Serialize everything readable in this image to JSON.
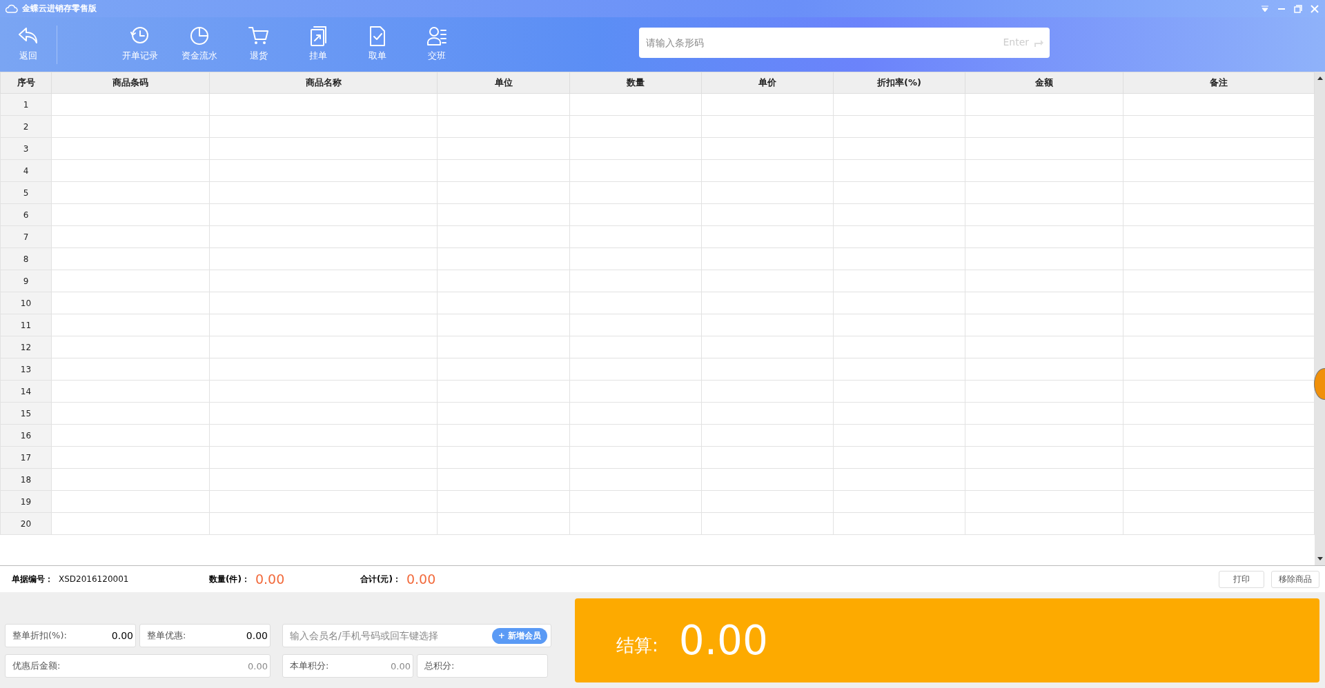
{
  "window": {
    "title": "金蝶云进销存零售版"
  },
  "toolbar": {
    "back": "返回",
    "items": [
      "开单记录",
      "资金流水",
      "退货",
      "挂单",
      "取单",
      "交班"
    ]
  },
  "barcode_field": {
    "placeholder": "请输入条形码",
    "hint": "Enter"
  },
  "table": {
    "columns": [
      "序号",
      "商品条码",
      "商品名称",
      "单位",
      "数量",
      "单价",
      "折扣率(%)",
      "金额",
      "备注"
    ],
    "rows": [
      "1",
      "2",
      "3",
      "4",
      "5",
      "6",
      "7",
      "8",
      "9",
      "10",
      "11",
      "12",
      "13",
      "14",
      "15",
      "16",
      "17",
      "18",
      "19",
      "20"
    ]
  },
  "summary": {
    "order_label": "单据编号：",
    "order_no": "XSD2016120001",
    "qty_label": "数量(件)：",
    "qty": "0.00",
    "total_label": "合计(元)：",
    "total": "0.00",
    "buttons": [
      "打印",
      "移除商品"
    ]
  },
  "fields": {
    "discount_label": "整单折扣(%):",
    "discount": "0.00",
    "offer_label": "整单优惠:",
    "offer": "0.00",
    "after_label": "优惠后金额:",
    "after": "0.00",
    "member_placeholder": "输入会员名/手机号码或回车键选择",
    "add_member": "+ 新增会员",
    "points_label": "本单积分:",
    "points": "0.00",
    "total_points_label": "总积分:"
  },
  "checkout": {
    "label": "结算:",
    "amount": "0.00"
  }
}
